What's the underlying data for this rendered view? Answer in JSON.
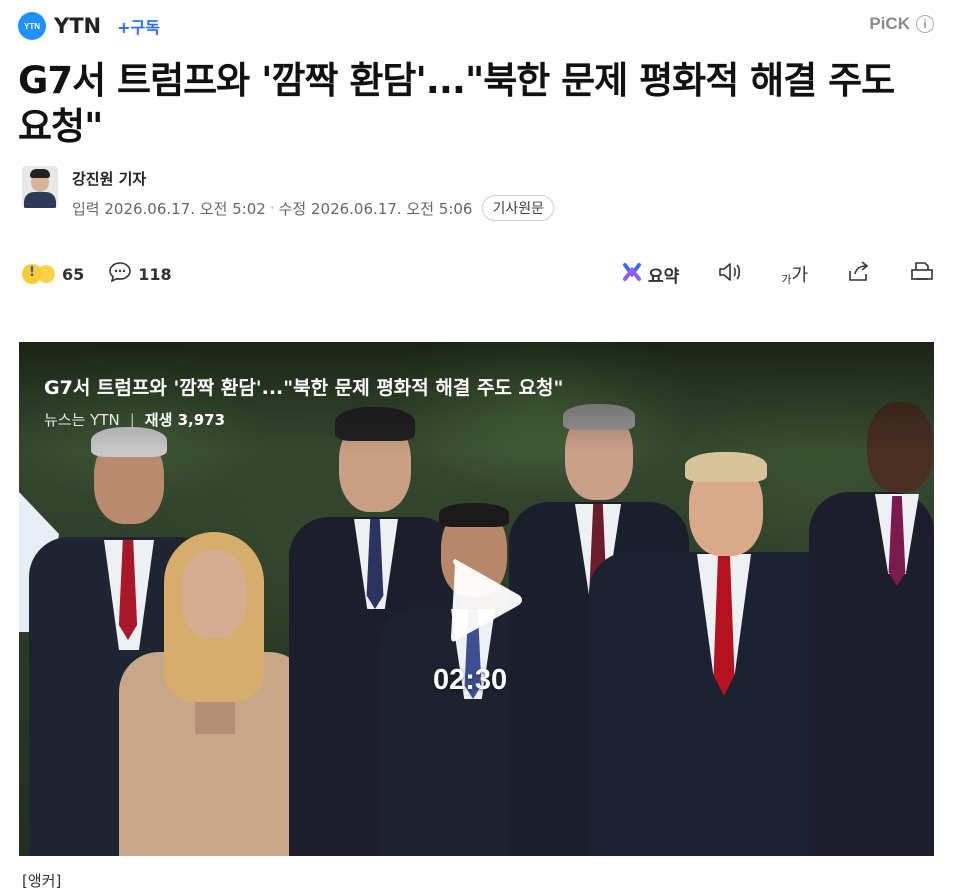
{
  "header": {
    "logo_text": "YTN",
    "press_name": "YTN",
    "subscribe_label": "+구독",
    "pick_label": "PiCK",
    "info_icon": "info-icon"
  },
  "article": {
    "title": "G7서 트럼프와 '깜짝 환담'...\"북한 문제 평화적 해결 주도 요청\"",
    "author": "강진원 기자",
    "published": "입력 2026.06.17. 오전 5:02",
    "updated": "수정 2026.06.17. 오전 5:06",
    "original_label": "기사원문"
  },
  "toolbar": {
    "reaction_count": "65",
    "comment_count": "118",
    "summary_label": "요약",
    "font_label_small": "가",
    "font_label_large": "가",
    "icons": [
      "summary-icon",
      "audio-icon",
      "font-size-icon",
      "share-icon",
      "print-icon"
    ]
  },
  "video": {
    "title": "G7서 트럼프와 '깜짝 환담'...\"북한 문제 평화적 해결 주도 요청\"",
    "channel": "뉴스는 YTN",
    "views": "재생 3,973",
    "duration": "02:30"
  },
  "body_start": "[앵커]"
}
